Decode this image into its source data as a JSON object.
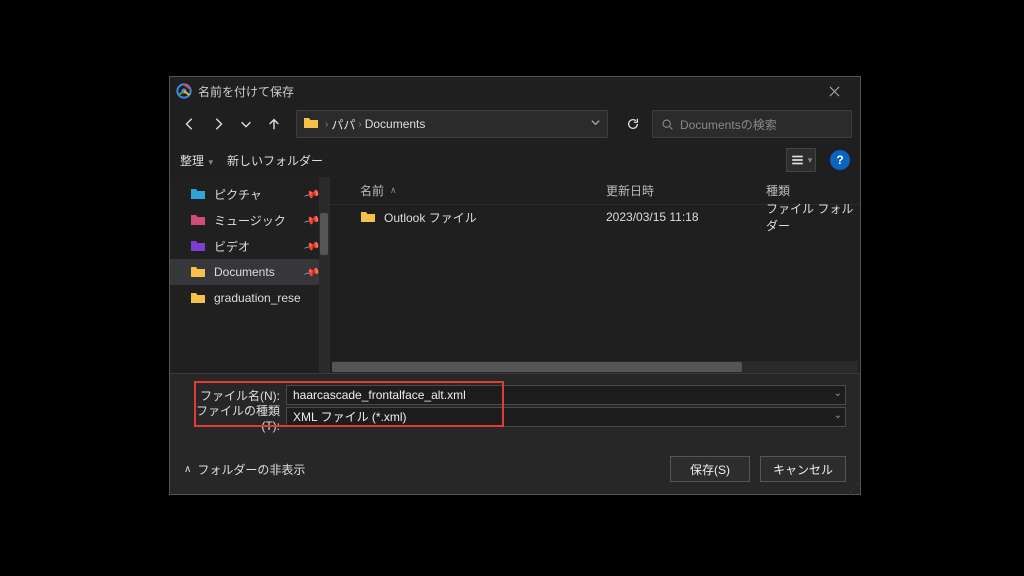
{
  "title": "名前を付けて保存",
  "breadcrumb": {
    "items": [
      "パパ",
      "Documents"
    ]
  },
  "search_placeholder": "Documentsの検索",
  "toolbar": {
    "organize": "整理",
    "new_folder": "新しいフォルダー"
  },
  "sidebar": {
    "items": [
      {
        "label": "ピクチャ",
        "color": "#2aa6d8",
        "pinned": true
      },
      {
        "label": "ミュージック",
        "color": "#d14a7a",
        "pinned": true
      },
      {
        "label": "ビデオ",
        "color": "#7a3fd1",
        "pinned": true
      },
      {
        "label": "Documents",
        "color": "#f5c148",
        "pinned": true,
        "selected": true
      },
      {
        "label": "graduation_rese",
        "color": "#f5c148",
        "pinned": false
      }
    ]
  },
  "file_columns": {
    "name": "名前",
    "modified": "更新日時",
    "type": "種類"
  },
  "files": [
    {
      "name": "Outlook ファイル",
      "modified": "2023/03/15 11:18",
      "type": "ファイル フォルダー"
    }
  ],
  "filename_label": "ファイル名(N):",
  "filetype_label": "ファイルの種類(T):",
  "filename_value": "haarcascade_frontalface_alt.xml",
  "filetype_value": "XML ファイル (*.xml)",
  "hide_folders": "フォルダーの非表示",
  "save_label": "保存(S)",
  "cancel_label": "キャンセル",
  "help_label": "?"
}
